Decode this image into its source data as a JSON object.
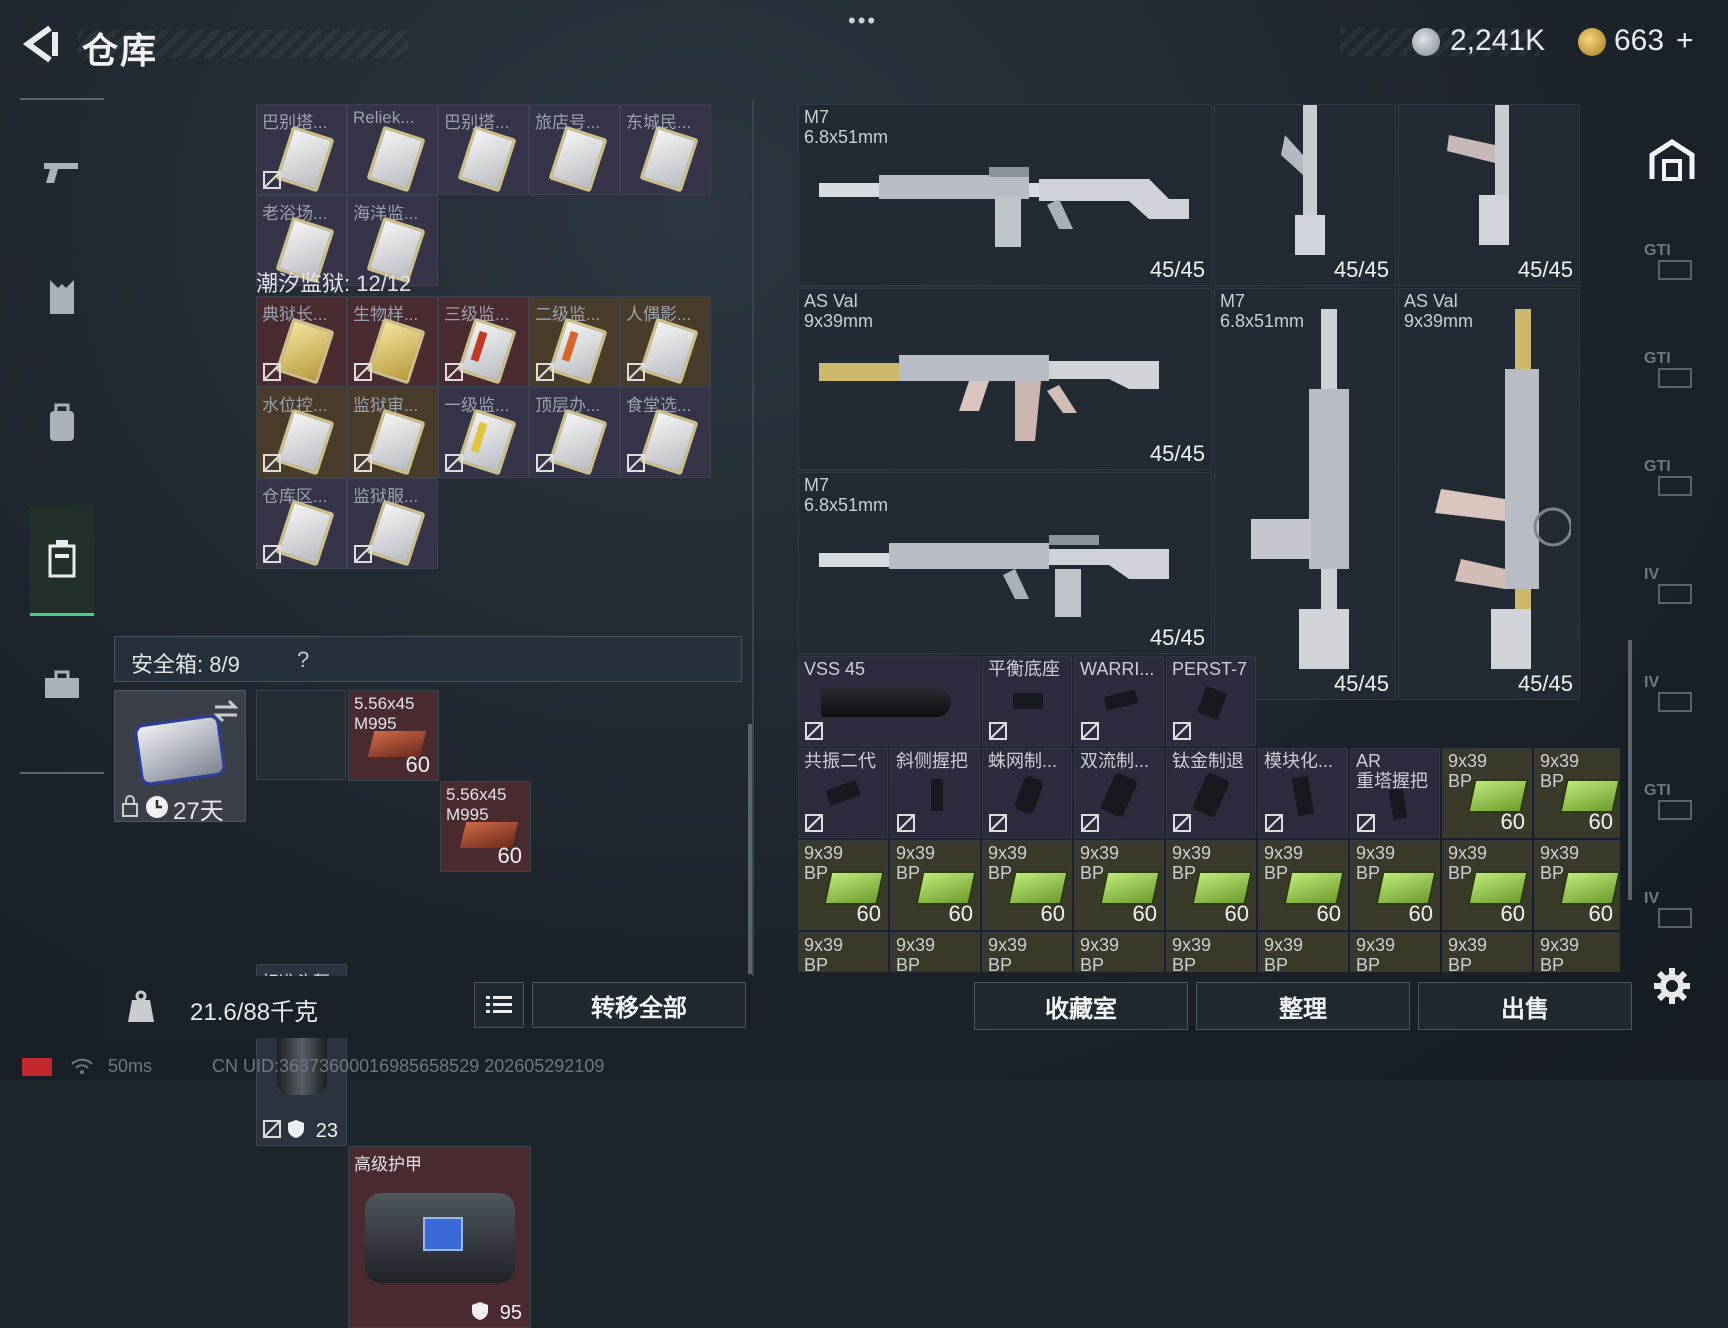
{
  "header": {
    "title": "仓库",
    "menu_dots": "•••",
    "currency1": "2,241K",
    "currency2": "663",
    "currency2_plus": "+",
    "coin1_color": "#9aa0a6",
    "coin2_color": "#d4a53a"
  },
  "sidebar": {
    "items": [
      {
        "icon": "gun-icon"
      },
      {
        "icon": "armor-vest-icon"
      },
      {
        "icon": "backpack-icon"
      },
      {
        "icon": "storage-locker-icon",
        "active": true
      },
      {
        "icon": "briefcase-icon"
      }
    ]
  },
  "keys_top": {
    "row1": [
      "巴别塔...",
      "Reliek...",
      "巴别塔...",
      "旅店号...",
      "东城民..."
    ],
    "row2": [
      "老浴场...",
      "海洋监..."
    ]
  },
  "tidal_prison": {
    "title": "潮汐监狱: 12/12",
    "row1": [
      "典狱长...",
      "生物样...",
      "三级监...",
      "二级监...",
      "人偶影..."
    ],
    "row2": [
      "水位控...",
      "监狱审...",
      "一级监...",
      "顶层办...",
      "食堂选..."
    ],
    "row3": [
      "仓库区...",
      "监狱服..."
    ]
  },
  "safebox": {
    "title": "安全箱: 8/9",
    "help": "?",
    "days": "27天",
    "ammo1_label": "5.56x45\nM995",
    "ammo1_count": "60",
    "ammo2_label": "5.56x45\nM995",
    "ammo2_count": "60",
    "helmet_label": "标准头盔",
    "helmet_durability": "23",
    "armor_label": "高级护甲",
    "armor_durability": "95"
  },
  "footer_left": {
    "weight": "21.6/88千克",
    "transfer_all": "转移全部"
  },
  "stash": {
    "weapons": [
      {
        "name": "M7\n6.8x51mm",
        "count": "45/45"
      },
      {
        "name": "",
        "count": "45/45"
      },
      {
        "name": "",
        "count": "45/45"
      },
      {
        "name": "AS Val\n9x39mm",
        "count": "45/45"
      },
      {
        "name": "M7\n6.8x51mm",
        "count": "45/45"
      },
      {
        "name": "AS Val\n9x39mm",
        "count": "45/45"
      },
      {
        "name": "M7\n6.8x51mm",
        "count": "45/45"
      }
    ],
    "attach_row1": [
      "VSS 45",
      "平衡底座",
      "WARRI...",
      "PERST-7"
    ],
    "attach_row2": [
      "共振二代",
      "斜侧握把",
      "蛛网制...",
      "双流制...",
      "钛金制退",
      "模块化...",
      "AR\n重塔握把"
    ],
    "ammo_label": "9x39\nBP",
    "ammo_count": "60",
    "ammo_short": "9x39\nBP"
  },
  "footer_right": {
    "collection": "收藏室",
    "sort": "整理",
    "sell": "出售"
  },
  "right_nav": {
    "items": [
      "GTI",
      "GTI",
      "GTI",
      "IV",
      "IV",
      "GTI",
      "IV"
    ]
  },
  "status": {
    "ping": "50ms",
    "uid": "CN UID:363736000169856585​29 202605292109"
  }
}
